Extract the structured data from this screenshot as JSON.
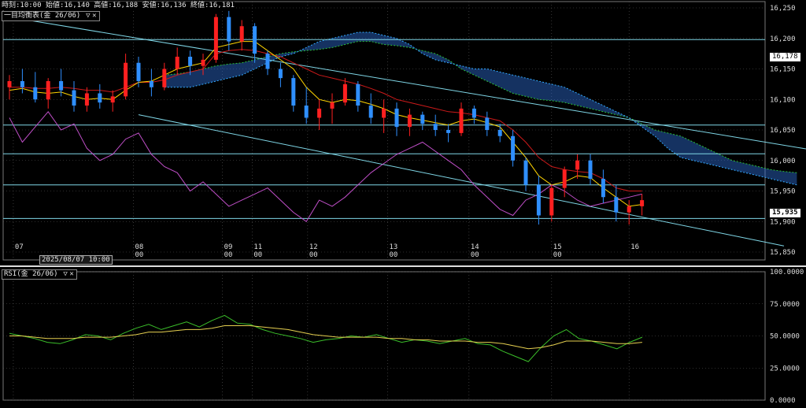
{
  "header": {
    "time_label": "時刻:10:00",
    "open_label": "始値:16,140",
    "high_label": "高値:16,188",
    "low_label": "安値:16,136",
    "close_label": "終値:16,181"
  },
  "indicator": {
    "label": "一目均衡表(金 26/06)",
    "dropdown_icon": "triangle-down-icon",
    "close_icon": "x-icon"
  },
  "rsi_panel": {
    "label": "RSI(金 26/06)"
  },
  "cursor_date": "2025/08/07 10:00",
  "price_tags": {
    "reference": "16,178",
    "last": "15,935"
  },
  "colors": {
    "background": "#000000",
    "up_candle": "#ff2020",
    "down_candle": "#2f8fff",
    "tenkan": "#ffd400",
    "kijun": "#cc1a1a",
    "chikou": "#c04fc8",
    "span_a": "#2bbf3a",
    "span_b": "#33aaff",
    "cloud": "#2f6fd8",
    "trendline": "#7fd6e6",
    "rsi": "#3bbf2a",
    "rsi_avg": "#e6d050",
    "grid": "#5a5a5a"
  },
  "chart_data": [
    {
      "type": "candlestick",
      "title": "",
      "ylim": [
        15850,
        16250
      ],
      "y_ticks": [
        "16,250",
        "16,200",
        "16,150",
        "16,100",
        "16,050",
        "16,000",
        "15,950",
        "15,900",
        "15,850"
      ],
      "x_day_labels": [
        "07",
        "08",
        "09",
        "11",
        "12",
        "13",
        "14",
        "15",
        "16"
      ],
      "x_hour_labels": [
        "00",
        "00",
        "00",
        "00",
        "00",
        "00",
        "00"
      ],
      "x_day_positions": [
        0.3,
        9.6,
        16.5,
        18.8,
        23.1,
        29.3,
        35.6,
        42.0,
        48.0
      ],
      "hour_positions": [
        9.6,
        16.5,
        18.8,
        23.1,
        29.3,
        35.6,
        42.0,
        48.0
      ],
      "hour_label_map": [
        0,
        1,
        2,
        3,
        4,
        5,
        6,
        7
      ],
      "ohlc": [
        [
          16120,
          16140,
          16100,
          16130
        ],
        [
          16130,
          16150,
          16110,
          16120
        ],
        [
          16120,
          16145,
          16095,
          16100
        ],
        [
          16100,
          16135,
          16085,
          16130
        ],
        [
          16130,
          16150,
          16105,
          16115
        ],
        [
          16115,
          16130,
          16080,
          16090
        ],
        [
          16090,
          16120,
          16080,
          16110
        ],
        [
          16110,
          16125,
          16085,
          16095
        ],
        [
          16095,
          16115,
          16080,
          16105
        ],
        [
          16105,
          16175,
          16100,
          16160
        ],
        [
          16160,
          16170,
          16120,
          16130
        ],
        [
          16130,
          16150,
          16105,
          16120
        ],
        [
          16120,
          16160,
          16115,
          16150
        ],
        [
          16150,
          16185,
          16140,
          16170
        ],
        [
          16170,
          16180,
          16140,
          16155
        ],
        [
          16155,
          16175,
          16140,
          16165
        ],
        [
          16165,
          16240,
          16160,
          16235
        ],
        [
          16235,
          16245,
          16180,
          16195
        ],
        [
          16195,
          16230,
          16180,
          16220
        ],
        [
          16220,
          16225,
          16160,
          16175
        ],
        [
          16175,
          16180,
          16140,
          16150
        ],
        [
          16150,
          16160,
          16120,
          16135
        ],
        [
          16135,
          16140,
          16080,
          16090
        ],
        [
          16090,
          16120,
          16060,
          16070
        ],
        [
          16070,
          16100,
          16050,
          16085
        ],
        [
          16085,
          16110,
          16060,
          16095
        ],
        [
          16095,
          16135,
          16090,
          16125
        ],
        [
          16125,
          16130,
          16080,
          16090
        ],
        [
          16090,
          16110,
          16060,
          16070
        ],
        [
          16070,
          16100,
          16045,
          16085
        ],
        [
          16085,
          16095,
          16040,
          16055
        ],
        [
          16055,
          16085,
          16040,
          16075
        ],
        [
          16075,
          16080,
          16050,
          16060
        ],
        [
          16060,
          16075,
          16040,
          16050
        ],
        [
          16050,
          16060,
          16030,
          16045
        ],
        [
          16045,
          16095,
          16040,
          16085
        ],
        [
          16085,
          16090,
          16060,
          16070
        ],
        [
          16070,
          16080,
          16040,
          16050
        ],
        [
          16050,
          16060,
          16030,
          16040
        ],
        [
          16040,
          16050,
          15990,
          16000
        ],
        [
          16000,
          16005,
          15950,
          15960
        ],
        [
          15960,
          15975,
          15895,
          15910
        ],
        [
          15910,
          15960,
          15900,
          15955
        ],
        [
          15955,
          15990,
          15940,
          15985
        ],
        [
          15985,
          16010,
          15970,
          16000
        ],
        [
          16000,
          16010,
          15960,
          15970
        ],
        [
          15970,
          15985,
          15930,
          15940
        ],
        [
          15940,
          15960,
          15900,
          15915
        ],
        [
          15915,
          15935,
          15895,
          15925
        ],
        [
          15925,
          15945,
          15910,
          15935
        ]
      ],
      "tenkan": [
        16115,
        16118,
        16112,
        16110,
        16112,
        16105,
        16100,
        16102,
        16100,
        16115,
        16128,
        16130,
        16140,
        16150,
        16155,
        16160,
        16185,
        16190,
        16195,
        16195,
        16180,
        16165,
        16150,
        16120,
        16100,
        16095,
        16100,
        16098,
        16092,
        16085,
        16075,
        16070,
        16066,
        16062,
        16058,
        16065,
        16068,
        16062,
        16055,
        16030,
        16005,
        15975,
        15960,
        15965,
        15975,
        15972,
        15955,
        15940,
        15925,
        15928
      ],
      "kijun": [
        16120,
        16120,
        16118,
        16118,
        16120,
        16118,
        16115,
        16115,
        16112,
        16120,
        16128,
        16128,
        16132,
        16140,
        16145,
        16150,
        16175,
        16180,
        16182,
        16180,
        16175,
        16170,
        16160,
        16150,
        16140,
        16135,
        16130,
        16125,
        16118,
        16110,
        16100,
        16095,
        16090,
        16085,
        16080,
        16078,
        16075,
        16070,
        16065,
        16050,
        16030,
        16005,
        15990,
        15985,
        15982,
        15980,
        15970,
        15955,
        15950,
        15950
      ],
      "chikou_offset": -26,
      "chikou": [
        16070,
        16030,
        16055,
        16080,
        16050,
        16060,
        16020,
        16000,
        16010,
        16035,
        16045,
        16010,
        15990,
        15980,
        15950,
        15965,
        15945,
        15925,
        15935,
        15945,
        15955,
        15935,
        15915,
        15900,
        15935,
        15925,
        15940,
        15960,
        15980,
        15995,
        16010,
        16020,
        16030,
        16015,
        16000,
        15985,
        15960,
        15940,
        15920,
        15910,
        15935,
        15945,
        15960,
        15950,
        15935,
        15925,
        15930,
        15935,
        15940,
        15945
      ],
      "span_a": [
        16140,
        16142,
        16145,
        16150,
        16155,
        16158,
        16160,
        16165,
        16170,
        16175,
        16178,
        16180,
        16182,
        16185,
        16190,
        16195,
        16195,
        16190,
        16188,
        16185,
        16180,
        16175,
        16165,
        16150,
        16140,
        16130,
        16120,
        16110,
        16105,
        16100,
        16098,
        16095,
        16090,
        16085,
        16080,
        16075,
        16070,
        16060,
        16050,
        16045,
        16040,
        16030,
        16020,
        16010,
        16000,
        15995,
        15990,
        15985,
        15982,
        15980
      ],
      "span_b": [
        16120,
        16120,
        16120,
        16125,
        16130,
        16135,
        16140,
        16150,
        16160,
        16170,
        16175,
        16185,
        16195,
        16200,
        16205,
        16210,
        16210,
        16205,
        16200,
        16190,
        16175,
        16165,
        16160,
        16155,
        16150,
        16150,
        16145,
        16140,
        16135,
        16130,
        16125,
        16120,
        16110,
        16100,
        16090,
        16080,
        16070,
        16055,
        16040,
        16020,
        16005,
        16000,
        15995,
        15990,
        15985,
        15980,
        15975,
        15970,
        15965,
        15960
      ],
      "cloud_offset": 26,
      "trendlines": [
        {
          "x1": 0,
          "y1": 16235,
          "x2": 100,
          "y2": 15885
        },
        {
          "x1": 10,
          "y1": 16075,
          "x2": 60,
          "y2": 15860
        }
      ],
      "hlines": [
        16198,
        16058,
        16011,
        15960,
        15905
      ]
    },
    {
      "type": "line",
      "title": "",
      "ylim": [
        0,
        100
      ],
      "y_ticks": [
        "100.0000",
        "75.0000",
        "50.0000",
        "25.0000",
        "0.0000"
      ],
      "series": [
        {
          "values": [
            52,
            50,
            48,
            45,
            44,
            47,
            51,
            50,
            47,
            52,
            56,
            59,
            55,
            58,
            61,
            57,
            62,
            66,
            60,
            59,
            55,
            52,
            50,
            48,
            45,
            47,
            48,
            50,
            49,
            51,
            48,
            45,
            47,
            46,
            44,
            46,
            48,
            44,
            43,
            38,
            34,
            30,
            41,
            50,
            55,
            48,
            46,
            43,
            40,
            45,
            49
          ]
        },
        {
          "values": [
            50,
            50,
            49,
            48,
            48,
            48,
            49,
            49,
            49,
            50,
            51,
            53,
            53,
            54,
            55,
            55,
            56,
            58,
            58,
            58,
            57,
            56,
            55,
            53,
            51,
            50,
            49,
            49,
            49,
            49,
            48,
            48,
            47,
            47,
            46,
            46,
            46,
            45,
            45,
            44,
            42,
            40,
            41,
            43,
            46,
            46,
            46,
            45,
            44,
            44,
            45
          ]
        }
      ]
    }
  ]
}
